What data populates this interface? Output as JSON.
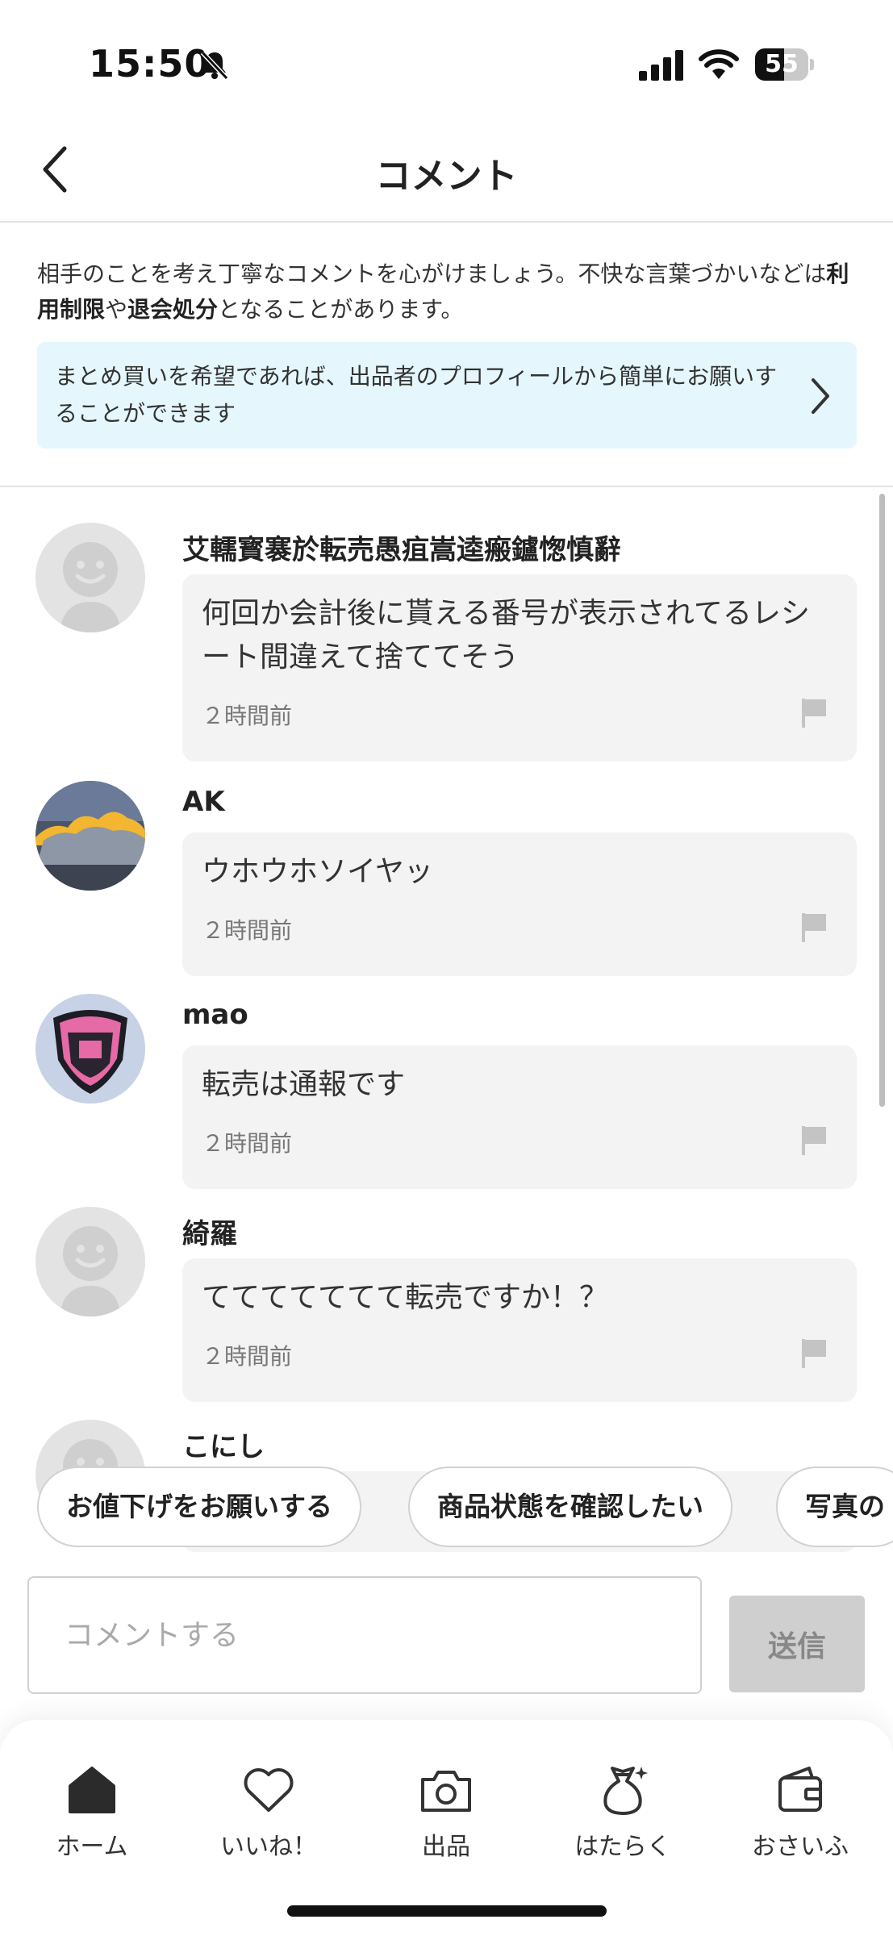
{
  "status_bar": {
    "time": "15:50",
    "battery": "55",
    "battery_level_percent": 55,
    "icons": [
      "bell-slash-icon",
      "signal-icon",
      "wifi-icon",
      "battery-icon"
    ]
  },
  "header": {
    "title": "コメント",
    "back_icon": "chevron-left-icon"
  },
  "notice": {
    "text_1": "相手のことを考え丁寧なコメントを心がけましょう。不快な言葉づかいなどは",
    "bold_1": "利用制限",
    "text_2": "や",
    "bold_2": "退会処分",
    "text_3": "となることがあります。"
  },
  "info_banner": {
    "text": "まとめ買いを希望であれば、出品者のプロフィールから簡単にお願いすることができます",
    "background": "#e5f7fd",
    "icon": "chevron-right-icon"
  },
  "comments": [
    {
      "username": "艾轜寳褰於転売愚疽嵩逵瘢鑪愡慎辭",
      "text": "何回か会計後に貰える番号が表示されてるレシート間違えて捨ててそう",
      "time": "２時間前",
      "avatar": "default-avatar-icon"
    },
    {
      "username": "AK",
      "text": "ウホウホソイヤッ",
      "time": "２時間前",
      "avatar": "sky-photo-avatar"
    },
    {
      "username": "mao",
      "text": "転売は通報です",
      "time": "２時間前",
      "avatar": "pink-emblem-avatar"
    },
    {
      "username": "綺羅",
      "text": "ててててててて転売ですか！？",
      "time": "２時間前",
      "avatar": "default-avatar-icon"
    },
    {
      "username": "こにし",
      "text": "",
      "time": "",
      "avatar": "default-avatar-icon"
    }
  ],
  "quick_replies": [
    "お値下げをお願いする",
    "商品状態を確認したい",
    "写真の"
  ],
  "input": {
    "placeholder": "コメントする",
    "send_label": "送信"
  },
  "bottom_nav": [
    {
      "label": "ホーム",
      "icon": "home-icon",
      "active": true
    },
    {
      "label": "いいね！",
      "icon": "heart-icon"
    },
    {
      "label": "出品",
      "icon": "camera-icon"
    },
    {
      "label": "はたらく",
      "icon": "money-bag-icon"
    },
    {
      "label": "おさいふ",
      "icon": "wallet-icon"
    }
  ]
}
